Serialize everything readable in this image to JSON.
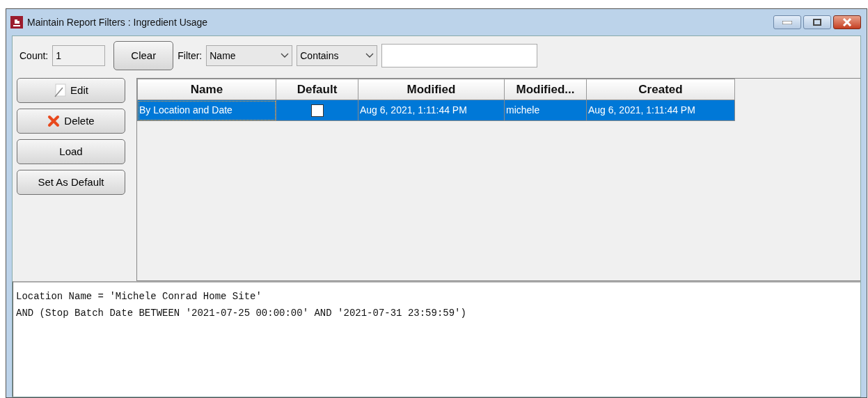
{
  "window": {
    "title": "Maintain Report Filters : Ingredient Usage"
  },
  "toolbar": {
    "count_label": "Count:",
    "count_value": "1",
    "clear_button": "Clear",
    "filter_label": "Filter:",
    "filter_field": "Name",
    "filter_operator": "Contains"
  },
  "side_buttons": [
    {
      "label": "Edit",
      "kind": "edit"
    },
    {
      "label": "Delete",
      "kind": "delete"
    },
    {
      "label": "Load",
      "kind": "plain"
    },
    {
      "label": "Set As Default",
      "kind": "plain"
    }
  ],
  "table": {
    "columns": [
      "Name",
      "Default",
      "Modified",
      "Modified...",
      "Created"
    ],
    "rows": [
      {
        "name": "By Location and Date",
        "default": false,
        "modified": "Aug 6, 2021, 1:11:44 PM",
        "modified_by": "michele",
        "created": "Aug 6, 2021, 1:11:44 PM",
        "selected": true
      }
    ]
  },
  "filter_text": [
    "Location Name = 'Michele Conrad Home Site'",
    "AND (Stop Batch Date BETWEEN '2021-07-25 00:00:00' AND '2021-07-31 23:59:59')"
  ]
}
